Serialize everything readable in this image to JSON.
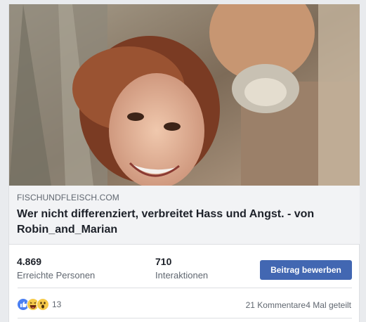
{
  "post": {
    "domain": "FISCHUNDFLEISCH.COM",
    "headline": "Wer nicht differenziert, verbreitet Hass und Angst. - von Robin_and_Marian"
  },
  "stats": {
    "reach_value": "4.869",
    "reach_label": "Erreichte Personen",
    "engagement_value": "710",
    "engagement_label": "Interaktionen",
    "boost_label": "Beitrag bewerben"
  },
  "footer": {
    "reactions": [
      "like-icon",
      "haha-icon",
      "wow-icon"
    ],
    "reaction_count": "13",
    "comments": "21 Kommentare",
    "shares": "4 Mal geteilt"
  },
  "colors": {
    "boost_button": "#4267b2",
    "meta_background": "#f2f3f5",
    "secondary_text": "#606770"
  }
}
